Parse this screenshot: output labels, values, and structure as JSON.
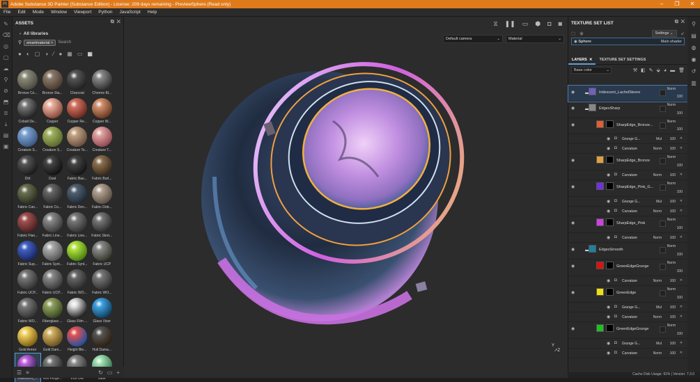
{
  "title": "Adobe Substance 3D Painter (Substance Edition) - License: 209 days remaining - PreviewSphere (Read only)",
  "menu": [
    "File",
    "Edit",
    "Mode",
    "Window",
    "Viewport",
    "Python",
    "JavaScript",
    "Help"
  ],
  "assets": {
    "title": "ASSETS",
    "library": "All libraries",
    "filter_chip": "smartmaterial",
    "search_placeholder": "Search",
    "items": [
      {
        "label": "Bronze Co...",
        "c1": "#8a8a7a",
        "c2": "#4a4a40"
      },
      {
        "label": "Bronze Sta...",
        "c1": "#8a7a6a",
        "c2": "#4a3a30"
      },
      {
        "label": "Charcoal",
        "c1": "#555",
        "c2": "#222"
      },
      {
        "label": "Chrome Bl...",
        "c1": "#888",
        "c2": "#333"
      },
      {
        "label": "Cobalt De...",
        "c1": "#777",
        "c2": "#222"
      },
      {
        "label": "Copper",
        "c1": "#e8b0a0",
        "c2": "#8a4a3a"
      },
      {
        "label": "Copper Re...",
        "c1": "#d07060",
        "c2": "#6a2a20"
      },
      {
        "label": "Copper W...",
        "c1": "#d09070",
        "c2": "#6a3a20"
      },
      {
        "label": "Creature S...",
        "c1": "#7aa0d0",
        "c2": "#3a5a80"
      },
      {
        "label": "Creature S...",
        "c1": "#a0b060",
        "c2": "#5a6a2a"
      },
      {
        "label": "Creature Te...",
        "c1": "#c0a080",
        "c2": "#6a5040"
      },
      {
        "label": "Creature T...",
        "c1": "#e0a0a0",
        "c2": "#904a50"
      },
      {
        "label": "Dirt",
        "c1": "#555",
        "c2": "#1a1a1a"
      },
      {
        "label": "Dust",
        "c1": "#444",
        "c2": "#111"
      },
      {
        "label": "Fabric Bas...",
        "c1": "#444",
        "c2": "#151515"
      },
      {
        "label": "Fabric Burl...",
        "c1": "#8a7050",
        "c2": "#3a2a1a"
      },
      {
        "label": "Fabric Can...",
        "c1": "#6a7050",
        "c2": "#2a3020"
      },
      {
        "label": "Fabric Co...",
        "c1": "#666",
        "c2": "#2a2a2a"
      },
      {
        "label": "Fabric Den...",
        "c1": "#506070",
        "c2": "#202a35"
      },
      {
        "label": "Fabric Dob...",
        "c1": "#b0a090",
        "c2": "#5a5045"
      },
      {
        "label": "Fabric Flan...",
        "c1": "#a05050",
        "c2": "#4a2020"
      },
      {
        "label": "Fabric Line...",
        "c1": "#888",
        "c2": "#3a3a3a"
      },
      {
        "label": "Fabric Line...",
        "c1": "#777",
        "c2": "#333"
      },
      {
        "label": "Fabric Stret...",
        "c1": "#777",
        "c2": "#2a2a2a"
      },
      {
        "label": "Fabric Sup...",
        "c1": "#4060c0",
        "c2": "#1a2560"
      },
      {
        "label": "Fabric Synt...",
        "c1": "#aaa",
        "c2": "#555"
      },
      {
        "label": "Fabric Synt...",
        "c1": "#b0e040",
        "c2": "#4a8010"
      },
      {
        "label": "Fabric UCP",
        "c1": "#888",
        "c2": "#3a3a30"
      },
      {
        "label": "Fabric UCP...",
        "c1": "#777",
        "c2": "#333"
      },
      {
        "label": "Fabric UCP...",
        "c1": "#888",
        "c2": "#3a3a3a"
      },
      {
        "label": "Fabric WO...",
        "c1": "#666",
        "c2": "#2a2a2a"
      },
      {
        "label": "Fabric WO...",
        "c1": "#777",
        "c2": "#333"
      },
      {
        "label": "Fabric WO...",
        "c1": "#777",
        "c2": "#333"
      },
      {
        "label": "Fiberglass ...",
        "c1": "#90a060",
        "c2": "#3a4a20"
      },
      {
        "label": "Glass Film ...",
        "c1": "#ddd",
        "c2": "#222"
      },
      {
        "label": "Glass Visor",
        "c1": "#40a0e0",
        "c2": "#104060"
      },
      {
        "label": "Gold Armor",
        "c1": "#f0d060",
        "c2": "#806010"
      },
      {
        "label": "Gold Dam...",
        "c1": "#d0b060",
        "c2": "#6a5020"
      },
      {
        "label": "Height Ble...",
        "c1": "#e05050",
        "c2": "#2050a0"
      },
      {
        "label": "Hull Dama...",
        "c1": "#555",
        "c2": "#302010"
      },
      {
        "label": "Iridescent_...",
        "c1": "#c060e0",
        "c2": "#202040"
      },
      {
        "label": "Iron Forge...",
        "c1": "#777",
        "c2": "#2a2a2a"
      },
      {
        "label": "Iron Old",
        "c1": "#888",
        "c2": "#333"
      },
      {
        "label": "Jade",
        "c1": "#a0e0b0",
        "c2": "#3a7050"
      }
    ]
  },
  "viewport": {
    "camera": "Default camera",
    "mode": "Material",
    "axis_y": "Y",
    "axis_z": "Z"
  },
  "texture_set_list": {
    "title": "TEXTURE SET LIST",
    "settings": "Settings",
    "set_name": "Sphere",
    "shader": "Main shader"
  },
  "layers_tabs": {
    "layers": "LAYERS",
    "tss": "TEXTURE SET SETTINGS",
    "channel": "Base color"
  },
  "layers": [
    {
      "type": "folder",
      "name": "Iridescent_LachelSteere",
      "blend": "Norm",
      "op": "100",
      "color": "#7060c0",
      "h": 23,
      "sel": true
    },
    {
      "type": "folder",
      "name": "EdgesSharp",
      "blend": "Norm",
      "op": "100",
      "color": "#888",
      "h": 24
    },
    {
      "type": "layer",
      "name": "SharpEdge_Bronze...",
      "blend": "Norm",
      "op": "100",
      "color": "#e06030",
      "h": 23
    },
    {
      "type": "fx",
      "name": "Grunge G...",
      "blend": "Mul",
      "op": "100",
      "h": 14
    },
    {
      "type": "fx",
      "name": "Curvature",
      "blend": "Norm",
      "op": "100",
      "h": 14
    },
    {
      "type": "layer",
      "name": "SharpEdge_Bronze",
      "blend": "Norm",
      "op": "100",
      "color": "#e0a040",
      "h": 24
    },
    {
      "type": "fx",
      "name": "Curvature",
      "blend": "Norm",
      "op": "100",
      "h": 14
    },
    {
      "type": "layer",
      "name": "SharpEdge_Pink_G...",
      "blend": "Norm",
      "op": "100",
      "color": "#7030e0",
      "h": 24
    },
    {
      "type": "fx",
      "name": "Grunge G...",
      "blend": "Mul",
      "op": "100",
      "h": 14
    },
    {
      "type": "fx",
      "name": "Curvature",
      "blend": "Norm",
      "op": "100",
      "h": 14
    },
    {
      "type": "layer",
      "name": "SharpEdge_Pink",
      "blend": "Norm",
      "op": "100",
      "color": "#d040e0",
      "h": 24
    },
    {
      "type": "fx",
      "name": "Curvature",
      "blend": "Norm",
      "op": "100",
      "h": 14
    },
    {
      "type": "folder",
      "name": "EdgesSmooth",
      "blend": "Norm",
      "op": "100",
      "color": "#2080a0",
      "h": 24
    },
    {
      "type": "layer",
      "name": "GreenEdgeGrunge",
      "blend": "Norm",
      "op": "100",
      "color": "#e01010",
      "h": 24
    },
    {
      "type": "fx",
      "name": "Curvature",
      "blend": "Norm",
      "op": "100",
      "h": 14
    },
    {
      "type": "layer",
      "name": "GreenEdge",
      "blend": "Norm",
      "op": "100",
      "color": "#f0e010",
      "h": 24
    },
    {
      "type": "fx",
      "name": "Grunge G...",
      "blend": "Mul",
      "op": "100",
      "h": 14
    },
    {
      "type": "fx",
      "name": "Curvature",
      "blend": "Norm",
      "op": "100",
      "h": 14
    },
    {
      "type": "layer",
      "name": "GreenEdgeGrunge",
      "blend": "Norm",
      "op": "100",
      "color": "#20c020",
      "h": 24
    },
    {
      "type": "fx",
      "name": "Grunge G...",
      "blend": "Mul",
      "op": "100",
      "h": 14
    },
    {
      "type": "fx",
      "name": "Curvature",
      "blend": "Norm",
      "op": "100",
      "h": 14
    }
  ],
  "status": "Cache Disk Usage:  91% | Version: 7.3.0"
}
